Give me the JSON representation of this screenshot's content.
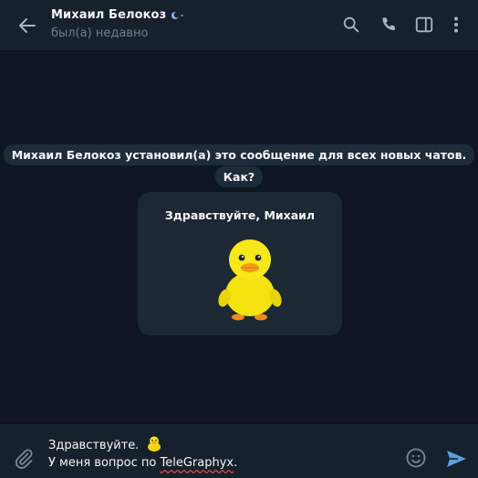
{
  "header": {
    "title": "Михаил Белокоз",
    "status": "был(а) недавно"
  },
  "chat": {
    "service_message_line1": "Михаил Белокоз установил(а) это сообщение для всех новых чатов.",
    "service_message_line2": "Как?",
    "greeting_title": "Здравствуйте, Михаил"
  },
  "composer": {
    "line1": "Здравствуйте.",
    "line2_prefix": "У меня вопрос по ",
    "line2_link": "TeleGraphyx",
    "line2_suffix": "."
  },
  "icons": {
    "back": "arrow-left-icon",
    "premium": "premium-badge-icon",
    "search": "search-icon",
    "call": "phone-icon",
    "sidebar": "sidebar-toggle-icon",
    "more": "more-vertical-icon",
    "attach": "paperclip-icon",
    "emoji": "smile-icon",
    "send": "send-icon"
  },
  "colors": {
    "background": "#0e1621",
    "header": "#17212b",
    "service_pill": "#1e2c3a",
    "card": "#1c2834",
    "muted_text": "#6d7f8f",
    "accent": "#5288c1",
    "send": "#5a9fe0"
  }
}
